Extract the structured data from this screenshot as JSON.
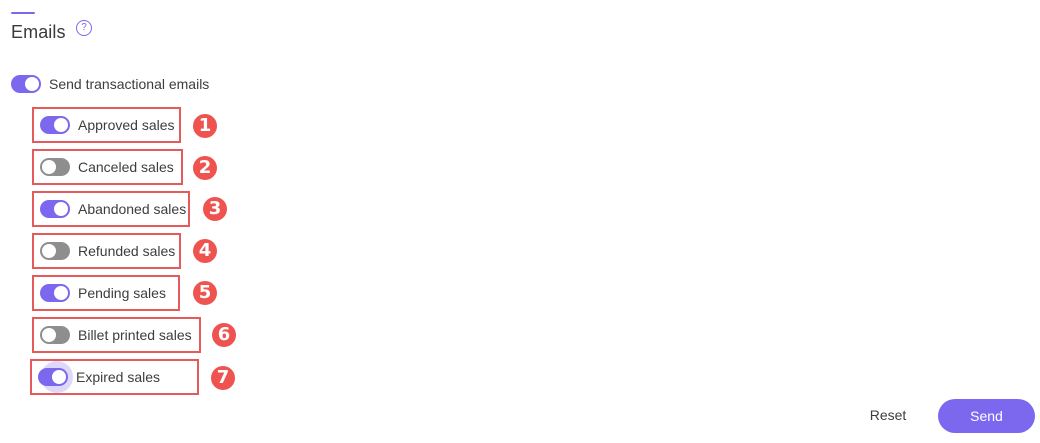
{
  "section": {
    "title": "Emails",
    "help_glyph": "?"
  },
  "master_toggle": {
    "label": "Send transactional emails",
    "enabled": true
  },
  "email_types": [
    {
      "badge": "1",
      "label": "Approved sales",
      "enabled": true
    },
    {
      "badge": "2",
      "label": "Canceled sales",
      "enabled": false
    },
    {
      "badge": "3",
      "label": "Abandoned sales",
      "enabled": true
    },
    {
      "badge": "4",
      "label": "Refunded sales",
      "enabled": false
    },
    {
      "badge": "5",
      "label": "Pending sales",
      "enabled": true
    },
    {
      "badge": "6",
      "label": "Billet printed sales",
      "enabled": false
    },
    {
      "badge": "7",
      "label": "Expired sales",
      "enabled": true
    }
  ],
  "actions": {
    "reset_label": "Reset",
    "send_label": "Send"
  },
  "colors": {
    "accent": "#7b68ee",
    "toggle_off": "#8e8e8e",
    "highlight": "#e55a5a",
    "badge": "#ef5350"
  }
}
